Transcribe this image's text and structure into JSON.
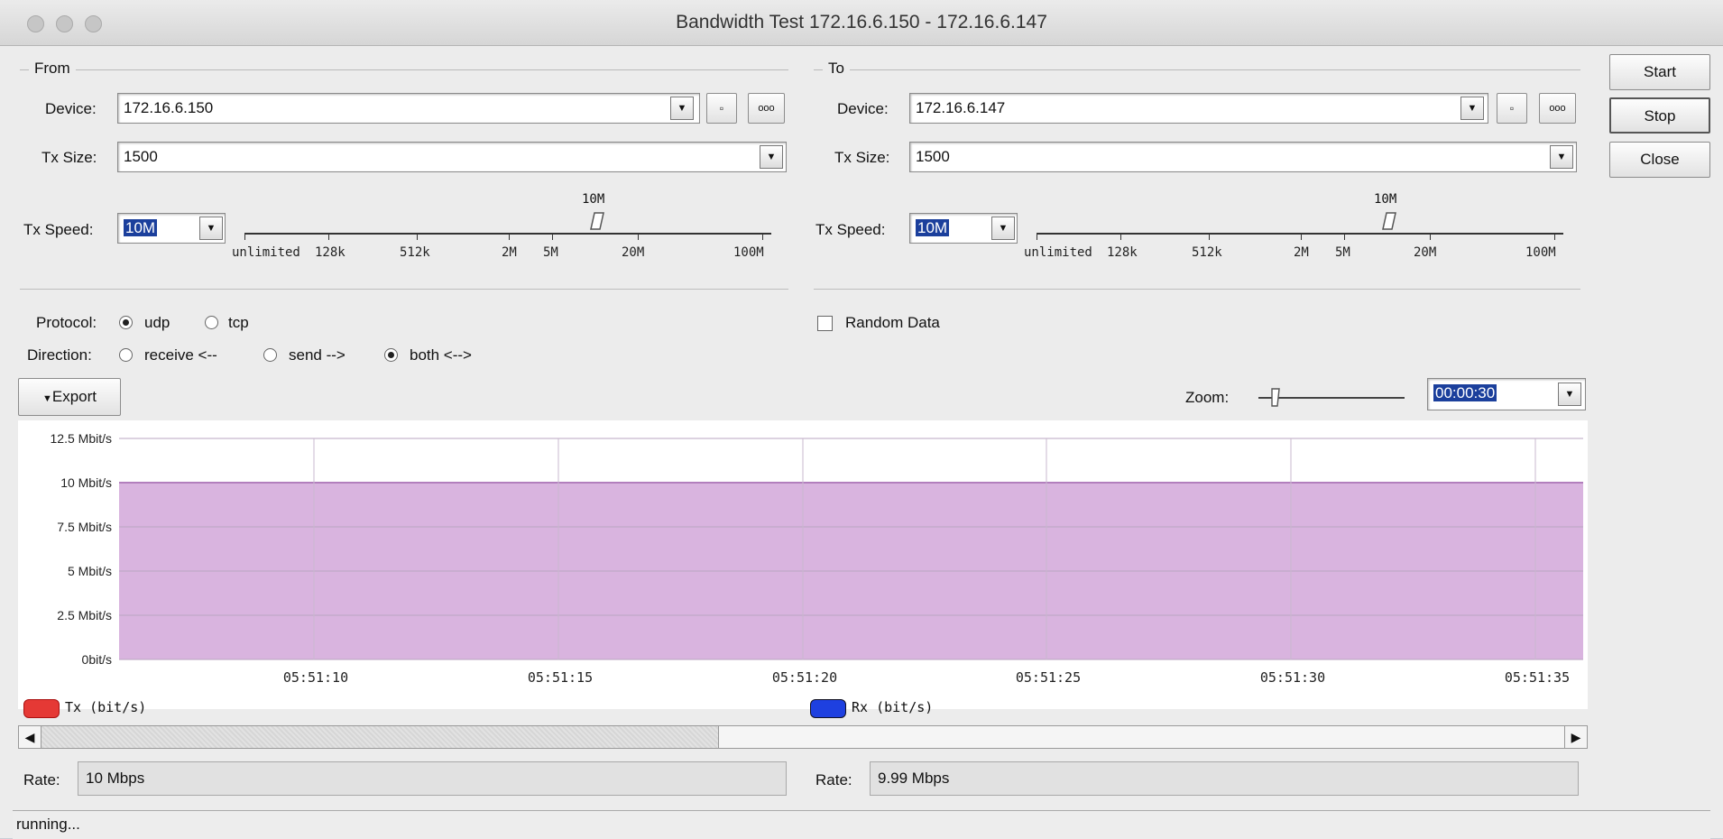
{
  "window": {
    "title": "Bandwidth Test 172.16.6.150 - 172.16.6.147"
  },
  "buttons": {
    "start": "Start",
    "stop": "Stop",
    "close": "Close",
    "export": "Export",
    "small": "▫",
    "dots": "ooo"
  },
  "from": {
    "group": "From",
    "device_label": "Device:",
    "device": "172.16.6.150",
    "tx_size_label": "Tx Size:",
    "tx_size": "1500",
    "tx_speed_label": "Tx Speed:",
    "tx_speed": "10M",
    "slider_marker": "10M"
  },
  "to": {
    "group": "To",
    "device_label": "Device:",
    "device": "172.16.6.147",
    "tx_size_label": "Tx Size:",
    "tx_size": "1500",
    "tx_speed_label": "Tx Speed:",
    "tx_speed": "10M",
    "slider_marker": "10M"
  },
  "slider_ticks": [
    "unlimited",
    "128k",
    "512k",
    "2M",
    "5M",
    "20M",
    "100M"
  ],
  "protocol": {
    "label": "Protocol:",
    "options": [
      "udp",
      "tcp"
    ],
    "selected": "udp"
  },
  "direction": {
    "label": "Direction:",
    "options": [
      "receive <--",
      "send -->",
      "both <-->"
    ],
    "selected": "both <-->"
  },
  "random_data": {
    "label": "Random Data",
    "checked": false
  },
  "zoom": {
    "label": "Zoom:",
    "value": "00:00:30"
  },
  "chart_data": {
    "type": "area",
    "y_ticks": [
      "12.5 Mbit/s",
      "10 Mbit/s",
      "7.5 Mbit/s",
      "5 Mbit/s",
      "2.5 Mbit/s",
      "0bit/s"
    ],
    "ylim": [
      0,
      12.5
    ],
    "x_ticks": [
      "05:51:10",
      "05:51:15",
      "05:51:20",
      "05:51:25",
      "05:51:30",
      "05:51:35"
    ],
    "series": [
      {
        "name": "Tx (bit/s)",
        "color": "#e53935",
        "values": [
          10,
          10,
          10,
          10,
          10,
          10
        ]
      },
      {
        "name": "Rx (bit/s)",
        "color": "#1e40e0",
        "values": [
          9.99,
          9.99,
          9.99,
          9.99,
          9.99,
          9.99
        ]
      }
    ],
    "overlap_fill": "#d9b4df",
    "grid": true,
    "legend": "bottom"
  },
  "rates": {
    "label": "Rate:",
    "tx": "10 Mbps",
    "rx": "9.99 Mbps"
  },
  "status": "running..."
}
